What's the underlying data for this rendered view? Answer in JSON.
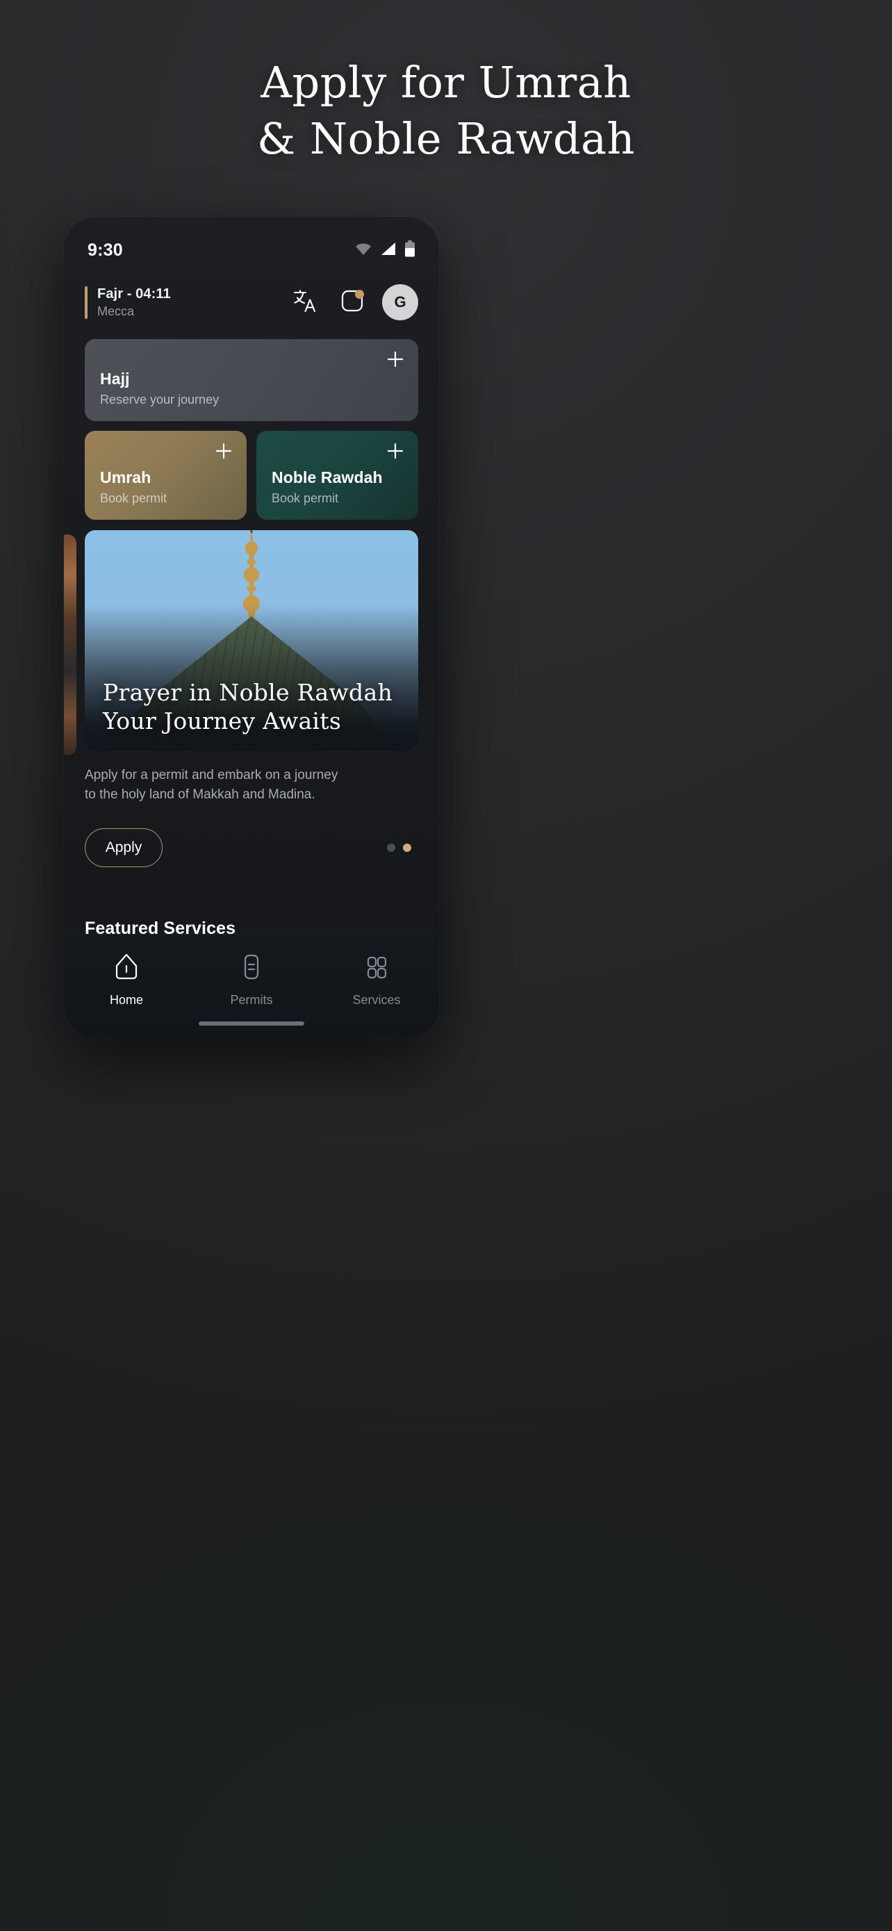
{
  "promo": {
    "line1": "Apply for Umrah",
    "line2": "& Noble Rawdah"
  },
  "phone": {
    "status": {
      "time": "9:30",
      "icons": [
        "wifi-icon",
        "cellular-signal-icon",
        "battery-icon"
      ]
    },
    "header": {
      "prayer_name_time": "Fajr - 04:11",
      "city": "Mecca",
      "actions": [
        {
          "name": "translate-icon",
          "label": "Translate"
        },
        {
          "name": "notifications-icon",
          "label": "Notifications",
          "badge": true
        },
        {
          "name": "avatar",
          "label": "G"
        }
      ],
      "accent_color": "#c39f6d"
    },
    "cards": [
      {
        "title": "Hajj",
        "subtitle": "Reserve your journey",
        "action_icon": "plus-icon",
        "color": "#4a4d54"
      },
      {
        "title": "Umrah",
        "subtitle": "Book permit",
        "action_icon": "plus-icon",
        "color": "#8d7a55"
      },
      {
        "title": "Noble Rawdah",
        "subtitle": "Book permit",
        "action_icon": "plus-icon",
        "color": "#1b443f"
      }
    ],
    "hero": {
      "title_line1": "Prayer in Noble Rawdah",
      "title_line2": "Your Journey Awaits",
      "body_line1": "Apply for a permit and embark on a journey",
      "body_line2": "to the holy land of Makkah and Madina.",
      "cta_label": "Apply",
      "cta_border_color": "#b49469",
      "pagination": {
        "count": 2,
        "active_index": 1,
        "active_color": "#cfab7d",
        "inactive_color": "#4a4e57"
      }
    },
    "featured": {
      "title": "Featured Services",
      "placeholder_count": 3
    },
    "bottom_nav": [
      {
        "label": "Home",
        "icon": "home-icon",
        "active": true
      },
      {
        "label": "Permits",
        "icon": "document-icon",
        "active": false
      },
      {
        "label": "Services",
        "icon": "grid-icon",
        "active": false
      }
    ]
  }
}
